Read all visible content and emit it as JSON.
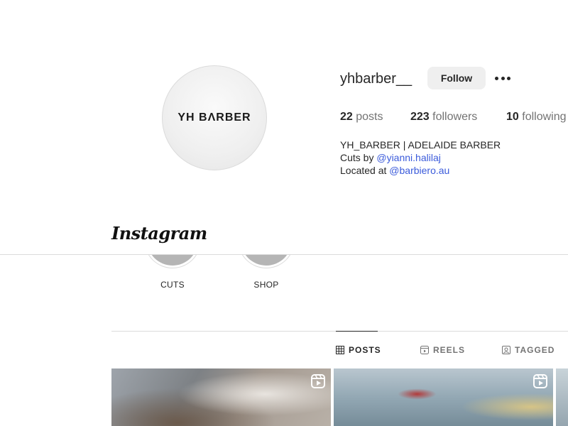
{
  "profile": {
    "avatar_text": "YH BΛRBER",
    "username": "yhbarber__",
    "follow_label": "Follow",
    "stats": {
      "posts_count": "22",
      "posts_label": "posts",
      "followers_count": "223",
      "followers_label": "followers",
      "following_count": "10",
      "following_label": "following"
    },
    "bio": {
      "name": "YH_BARBER | ADELAIDE BARBER",
      "line2_prefix": "Cuts by",
      "line2_link": "@yianni.halilaj",
      "line3_prefix": "Located at",
      "line3_link": "@barbiero.au"
    }
  },
  "highlights": [
    {
      "label": "CUTS"
    },
    {
      "label": "SHOP"
    }
  ],
  "topbar": {
    "logo_text": "Instagram"
  },
  "tabs": [
    {
      "label": "POSTS",
      "icon": "grid-icon",
      "active": true
    },
    {
      "label": "REELS",
      "icon": "reels-icon",
      "active": false
    },
    {
      "label": "TAGGED",
      "icon": "tagged-icon",
      "active": false
    }
  ],
  "posts": [
    {
      "type": "reel",
      "icon": "reel-icon"
    },
    {
      "type": "reel",
      "icon": "reel-icon"
    },
    {
      "type": "post"
    }
  ],
  "colors": {
    "link": "#3b5bdb",
    "button_bg": "#efefef",
    "divider": "#dbdbdb",
    "muted_text": "#737373"
  }
}
